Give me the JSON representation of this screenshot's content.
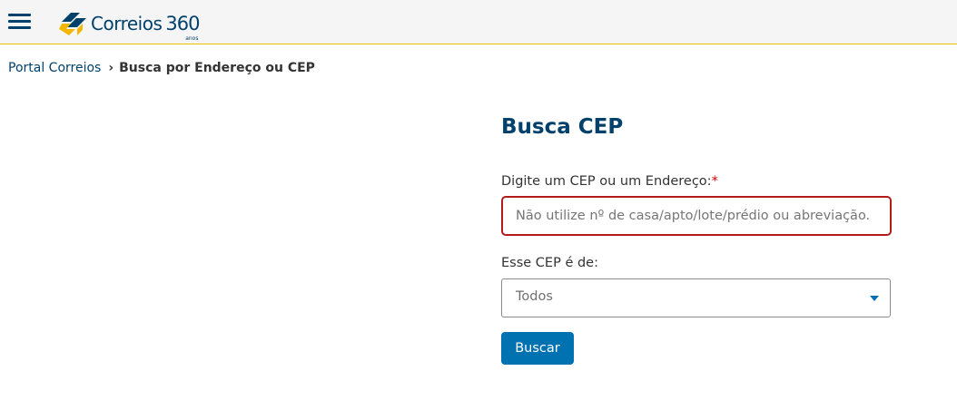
{
  "header": {
    "logo_text": "Correios",
    "logo_number": "360",
    "logo_anos": "anos",
    "menu_icon": "hamburger-menu-icon",
    "colors": {
      "brand_blue": "#00416b",
      "brand_yellow": "#f2b705",
      "header_border": "#e6c200"
    }
  },
  "breadcrumb": {
    "home_label": "Portal Correios",
    "separator": "›",
    "current_label": "Busca por Endereço ou CEP"
  },
  "form": {
    "title": "Busca CEP",
    "address_label": "Digite um CEP ou um Endereço:",
    "required_mark": "*",
    "address_placeholder": "Não utilize nº de casa/apto/lote/prédio ou abreviação.",
    "address_value": "",
    "type_label": "Esse CEP é de:",
    "type_selected": "Todos",
    "submit_label": "Buscar",
    "colors": {
      "input_border_error": "#b31b1b",
      "button_bg": "#0072b1"
    }
  }
}
